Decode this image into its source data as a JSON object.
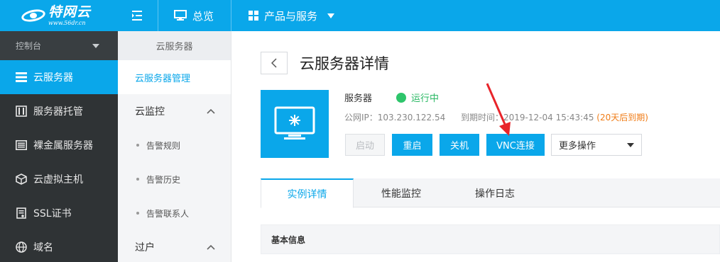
{
  "brand": {
    "name": "特网云",
    "url": "www.56dr.cn",
    "accent": "#0aa7ea"
  },
  "topnav": {
    "menu_icon": "menu-collapse-icon",
    "overview": {
      "label": "总览",
      "icon": "monitor-icon"
    },
    "products": {
      "label": "产品与服务",
      "icon": "grid-icon"
    }
  },
  "sidebar": {
    "console": "控制台",
    "items": [
      {
        "label": "云服务器",
        "icon": "server-list-icon",
        "active": true
      },
      {
        "label": "服务器托管",
        "icon": "rack-icon"
      },
      {
        "label": "裸金属服务器",
        "icon": "bare-metal-icon"
      },
      {
        "label": "云虚拟主机",
        "icon": "cube-icon"
      },
      {
        "label": "SSL证书",
        "icon": "certificate-icon"
      },
      {
        "label": "域名",
        "icon": "globe-icon"
      }
    ]
  },
  "subnav": {
    "header": "云服务器",
    "items": [
      {
        "label": "云服务器管理",
        "active": true
      },
      {
        "label": "云监控",
        "type": "group",
        "expanded": true
      },
      {
        "label": "告警规则",
        "type": "sub"
      },
      {
        "label": "告警历史",
        "type": "sub"
      },
      {
        "label": "告警联系人",
        "type": "sub"
      },
      {
        "label": "过户",
        "type": "group",
        "expanded": true
      }
    ]
  },
  "page": {
    "title": "云服务器详情",
    "server": {
      "label": "服务器",
      "status": "运行中",
      "status_color": "#2ec56b",
      "ip_label": "公网IP：",
      "ip": "103.230.122.54",
      "expiry_label": "到期时间：",
      "expiry": "2019-12-04 15:43:45",
      "expiry_note": "(20天后到期)",
      "expiry_note_color": "#f07c16"
    },
    "actions": {
      "start": "启动",
      "restart": "重启",
      "shutdown": "关机",
      "vnc": "VNC连接",
      "more": "更多操作"
    },
    "tabs": [
      {
        "label": "实例详情",
        "active": true
      },
      {
        "label": "性能监控"
      },
      {
        "label": "操作日志"
      }
    ],
    "section_title": "基本信息"
  }
}
